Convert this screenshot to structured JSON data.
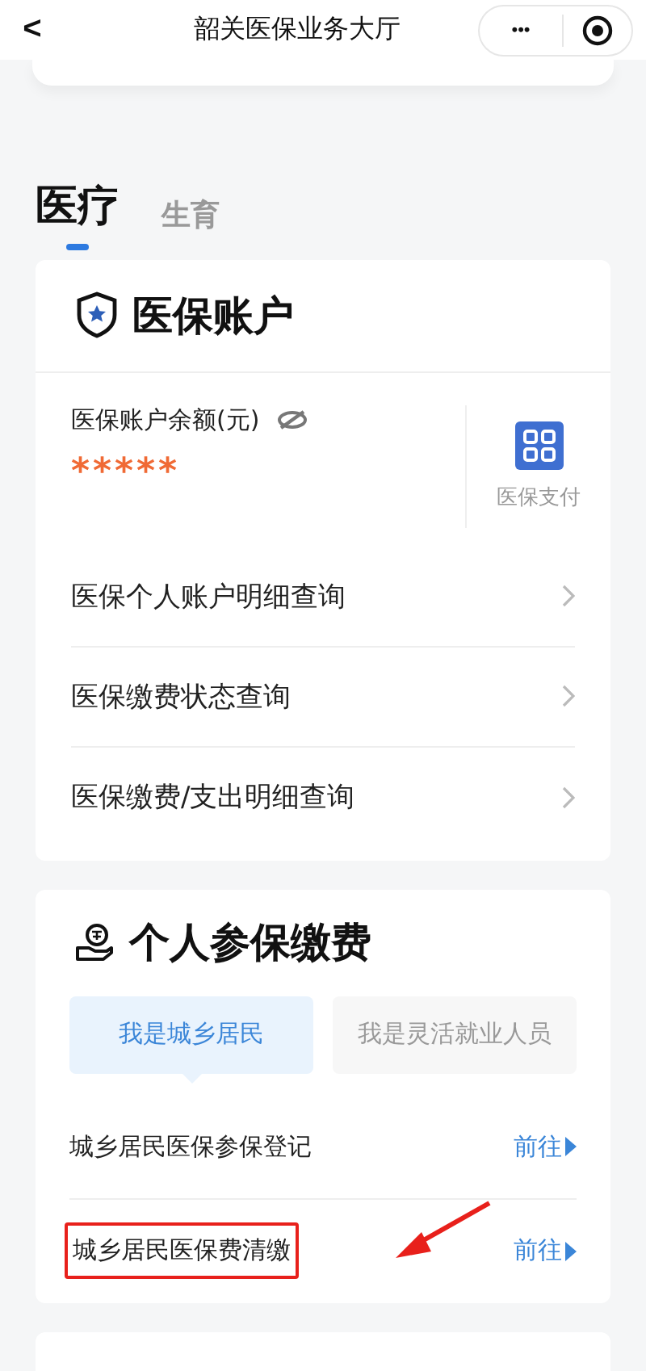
{
  "nav": {
    "back": "<",
    "title": "韶关医保业务大厅",
    "more": "•••"
  },
  "tabs": [
    {
      "label": "医疗",
      "selected": true
    },
    {
      "label": "生育",
      "selected": false
    }
  ],
  "account_card": {
    "title": "医保账户",
    "balance_label": "医保账户余额(元)",
    "balance": "*****",
    "balance_hidden": true,
    "pay_label": "医保支付",
    "links": [
      {
        "label": "医保个人账户明细查询"
      },
      {
        "label": "医保缴费状态查询"
      },
      {
        "label": "医保缴费/支出明细查询"
      }
    ]
  },
  "payment_card": {
    "title": "个人参保缴费",
    "segments": [
      {
        "label": "我是城乡居民",
        "selected": true
      },
      {
        "label": "我是灵活就业人员",
        "selected": false
      }
    ],
    "rows": [
      {
        "label": "城乡居民医保参保登记",
        "action": "前往",
        "highlighted": false
      },
      {
        "label": "城乡居民医保费清缴",
        "action": "前往",
        "highlighted": true
      }
    ]
  }
}
